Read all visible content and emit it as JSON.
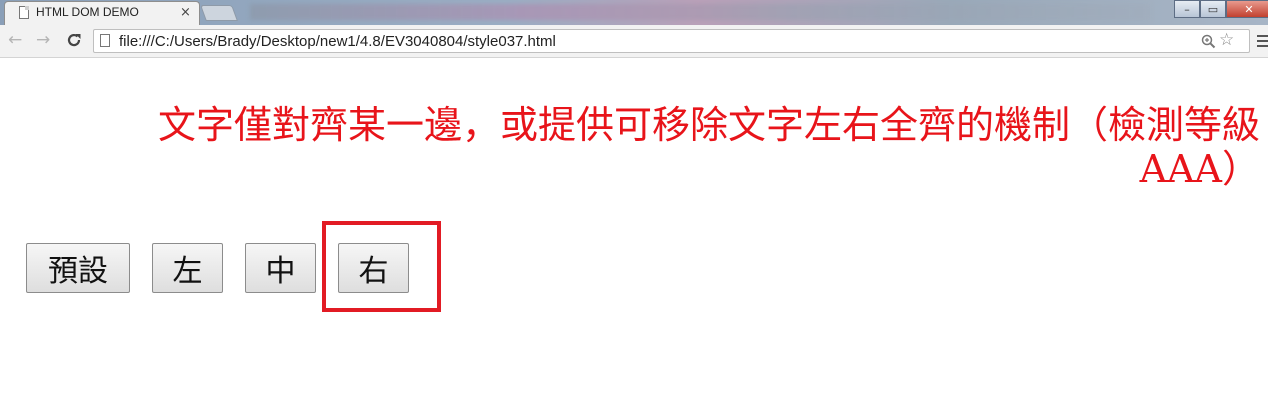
{
  "browser": {
    "tab_title": "HTML DOM DEMO",
    "tab_close": "×",
    "url": "file:///C:/Users/Brady/Desktop/new1/4.8/EV3040804/style037.html",
    "icons": {
      "back": "←",
      "forward": "→",
      "reload": "C",
      "zoom": "⊕",
      "star": "☆",
      "minimize": "–",
      "maximize": "▭",
      "close": "✕"
    }
  },
  "page": {
    "heading_line1": "文字僅對齊某一邊，或提供可移除文字左右全齊的機制（檢測等級",
    "heading_line2": "AAA）",
    "heading_color": "#e8141a",
    "buttons": {
      "default_label": "預設",
      "left_label": "左",
      "center_label": "中",
      "right_label": "右"
    },
    "highlight_color": "#e21b24"
  }
}
